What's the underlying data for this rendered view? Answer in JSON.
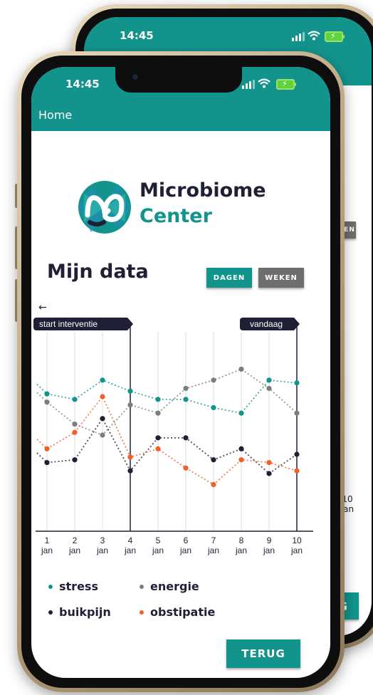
{
  "status_bar": {
    "time": "14:45"
  },
  "app_bar": {
    "title": "Home"
  },
  "brand": {
    "name_top": "Microbiome",
    "name_bottom": "Center"
  },
  "page_title": "Mijn data",
  "toggle": {
    "days_label": "DAGEN",
    "weeks_label": "WEKEN",
    "active": "DAGEN"
  },
  "chart_data": {
    "type": "line",
    "categories": [
      "1\njan",
      "2\njan",
      "3\njan",
      "4\njan",
      "5\njan",
      "6\njan",
      "7\njan",
      "8\njan",
      "9\njan",
      "10\njan"
    ],
    "x_tick_numbers": [
      "1",
      "2",
      "3",
      "4",
      "5",
      "6",
      "7",
      "8",
      "9",
      "10"
    ],
    "x_tick_unit": "jan",
    "annotations": [
      {
        "label": "start interventie",
        "at": "4"
      },
      {
        "label": "vandaag",
        "at": "10"
      }
    ],
    "arrow_label": "←",
    "series": [
      {
        "name": "stress",
        "color": "#12948c",
        "values": [
          7.0,
          6.8,
          7.5,
          7.1,
          6.8,
          6.8,
          6.5,
          6.3,
          7.5,
          7.4
        ]
      },
      {
        "name": "energie",
        "color": "#7d7d7d",
        "values": [
          6.7,
          5.9,
          5.5,
          6.6,
          6.3,
          7.2,
          7.5,
          7.9,
          7.2,
          6.3
        ]
      },
      {
        "name": "buikpijn",
        "color": "#1f2035",
        "values": [
          4.5,
          4.6,
          6.1,
          4.2,
          5.4,
          5.4,
          4.6,
          5.0,
          4.1,
          4.8
        ]
      },
      {
        "name": "obstipatie",
        "color": "#f0602a",
        "values": [
          5.0,
          5.6,
          6.9,
          4.7,
          5.0,
          4.3,
          3.7,
          4.6,
          4.5,
          4.2
        ]
      }
    ],
    "ylim": [
      2,
      9
    ]
  },
  "legend": [
    {
      "label": "stress",
      "color": "#12948c"
    },
    {
      "label": "energie",
      "color": "#7d7d7d"
    },
    {
      "label": "buikpijn",
      "color": "#1f2035"
    },
    {
      "label": "obstipatie",
      "color": "#f0602a"
    }
  ],
  "back_button": {
    "label": "TERUG"
  },
  "back_phone": {
    "time": "14:45",
    "weeks_label": "WEKEN",
    "tick_number": "10",
    "tick_unit": "jan",
    "button_label": "G"
  },
  "icons": {
    "wifi": "wifi-icon",
    "signal": "signal-icon",
    "battery": "battery-charging-icon",
    "logo": "microbiome-logo"
  }
}
